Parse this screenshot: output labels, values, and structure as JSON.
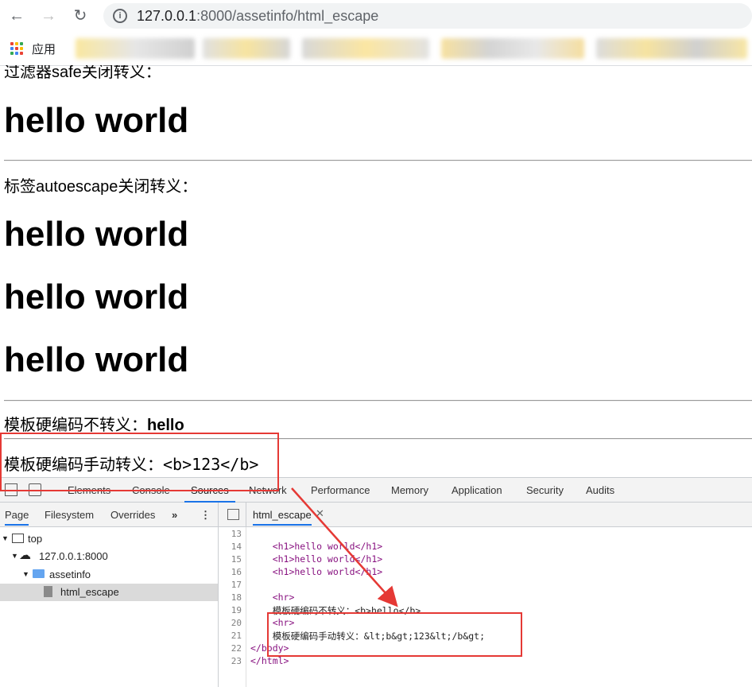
{
  "browser": {
    "url_host": "127.0.0.1",
    "url_rest": ":8000/assetinfo/html_escape",
    "apps_label": "应用"
  },
  "page": {
    "safe_label": "过滤器safe关闭转义：",
    "safe_h1": "hello world",
    "autoescape_label": "标签autoescape关闭转义：",
    "auto_h1": [
      "hello world",
      "hello world",
      "hello world"
    ],
    "hardcode_label": "模板硬编码不转义：",
    "hardcode_bold": "hello",
    "manual_label": "模板硬编码手动转义：",
    "manual_value": "<b>123</b>"
  },
  "devtools": {
    "tabs": [
      "Elements",
      "Console",
      "Sources",
      "Network",
      "Performance",
      "Memory",
      "Application",
      "Security",
      "Audits"
    ],
    "active_tab": "Sources",
    "nav_tabs": [
      "Page",
      "Filesystem",
      "Overrides",
      "»"
    ],
    "tree": [
      "top",
      "127.0.0.1:8000",
      "assetinfo",
      "html_escape"
    ],
    "file_tab": "html_escape",
    "line_numbers": [
      "13",
      "14",
      "15",
      "16",
      "17",
      "18",
      "19",
      "20",
      "21",
      "22",
      "23"
    ],
    "code": [
      "",
      "    <h1>hello world</h1>",
      "    <h1>hello world</h1>",
      "    <h1>hello world</h1>",
      "",
      "    <hr>",
      "    模板硬编码不转义：<b>hello</b>",
      "    <hr>",
      "    模板硬编码手动转义：&lt;b&gt;123&lt;/b&gt;",
      "</body>",
      "</html>"
    ]
  },
  "colors": {
    "accent": "#1a73e8",
    "annotation": "#e53935",
    "tag": "#881280"
  }
}
